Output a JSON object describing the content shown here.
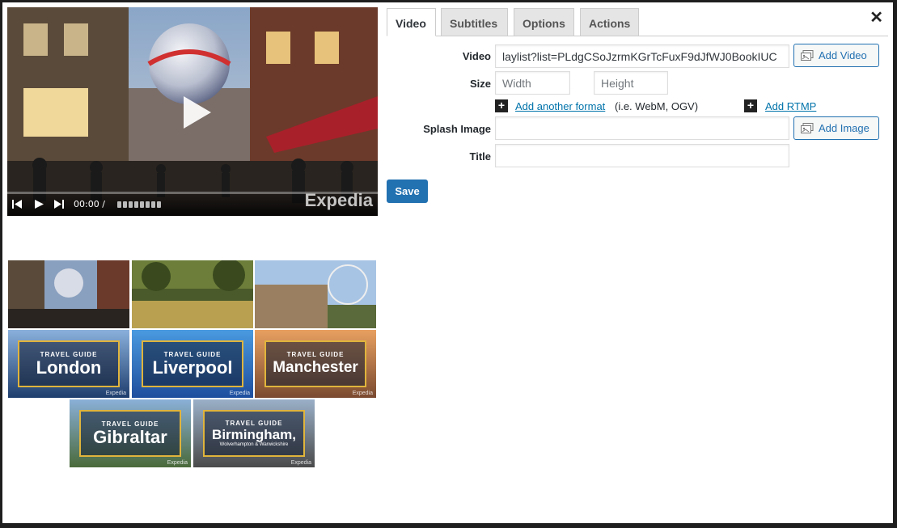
{
  "dialog": {
    "close_glyph": "✕"
  },
  "player": {
    "current_time": "00:00 /",
    "watermark": "Expedia"
  },
  "thumbnails": [
    {
      "id": "carnaby",
      "title": "",
      "subtitle": ""
    },
    {
      "id": "park",
      "title": "",
      "subtitle": ""
    },
    {
      "id": "london-eye",
      "title": "",
      "subtitle": ""
    },
    {
      "id": "london",
      "kicker": "TRAVEL GUIDE",
      "title": "London",
      "subtitle": ""
    },
    {
      "id": "liverpool",
      "kicker": "TRAVEL GUIDE",
      "title": "Liverpool",
      "subtitle": ""
    },
    {
      "id": "manchester",
      "kicker": "TRAVEL GUIDE",
      "title": "Manchester",
      "subtitle": ""
    },
    {
      "id": "gibraltar",
      "kicker": "TRAVEL GUIDE",
      "title": "Gibraltar",
      "subtitle": ""
    },
    {
      "id": "birmingham",
      "kicker": "TRAVEL GUIDE",
      "title": "Birmingham,",
      "subtitle": "Wolverhampton & Warwickshire"
    }
  ],
  "thumb_watermark": "Expedia",
  "tabs": [
    {
      "label": "Video",
      "active": true
    },
    {
      "label": "Subtitles",
      "active": false
    },
    {
      "label": "Options",
      "active": false
    },
    {
      "label": "Actions",
      "active": false
    }
  ],
  "form": {
    "video_label": "Video",
    "video_value": "laylist?list=PLdgCSoJzrmKGrTcFuxF9dJfWJ0BookIUC",
    "add_video": "Add Video",
    "size_label": "Size",
    "width_placeholder": "Width",
    "height_placeholder": "Height",
    "add_format_link": "Add another format",
    "add_format_hint": "(i.e. WebM, OGV)",
    "add_rtmp_link": "Add RTMP",
    "splash_label": "Splash Image",
    "splash_value": "",
    "add_image": "Add Image",
    "title_label": "Title",
    "title_value": "",
    "save": "Save"
  },
  "colors": {
    "primary": "#2271b1",
    "link": "#0073aa",
    "guide_border": "#e0b43c"
  }
}
